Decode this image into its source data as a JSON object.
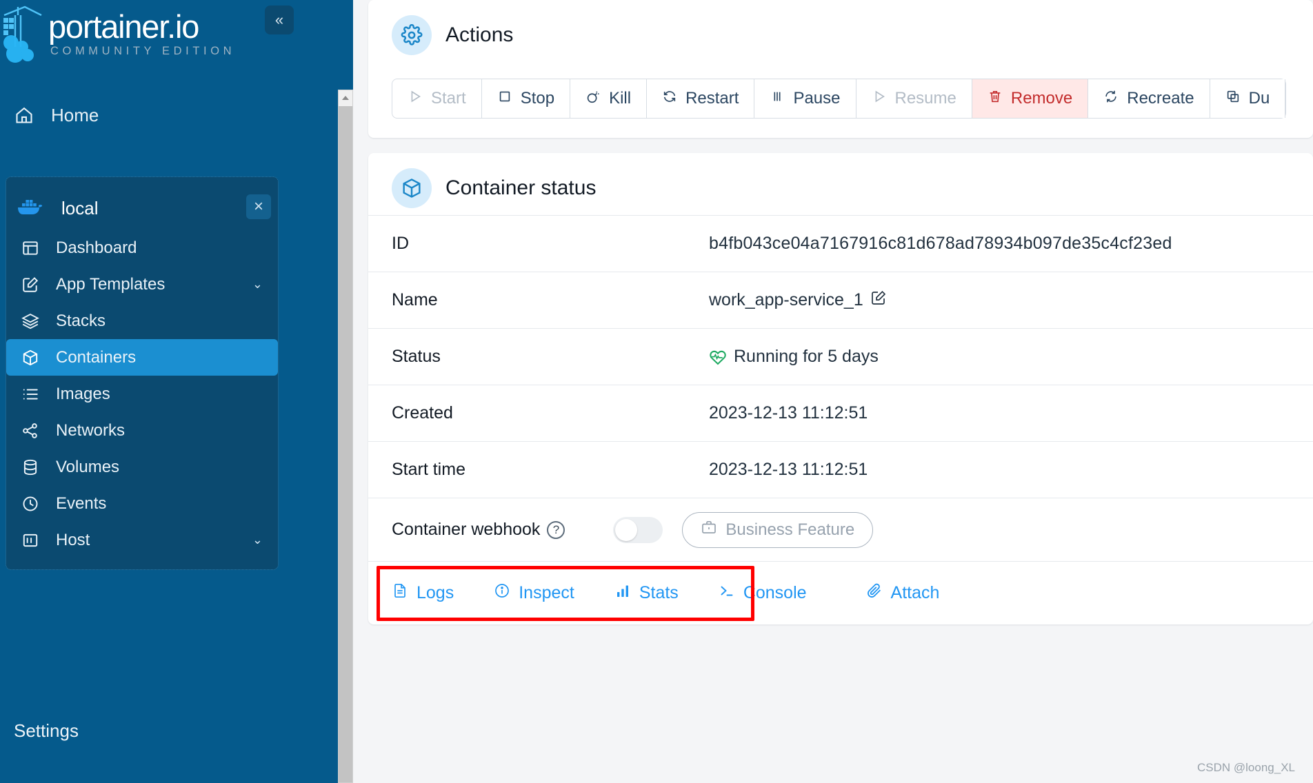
{
  "brand": {
    "name": "portainer.io",
    "edition": "COMMUNITY EDITION",
    "collapse_label": "«",
    "logo_icon": "portainer-crane-logo"
  },
  "sidebar": {
    "home": {
      "label": "Home",
      "icon": "home-icon"
    },
    "environment": {
      "name": "local",
      "icon": "docker-whale-icon",
      "close_label": "×"
    },
    "items": [
      {
        "label": "Dashboard",
        "icon": "dashboard-icon",
        "active": false,
        "chevron": ""
      },
      {
        "label": "App Templates",
        "icon": "edit-square-icon",
        "active": false,
        "chevron": "⌄"
      },
      {
        "label": "Stacks",
        "icon": "layers-icon",
        "active": false,
        "chevron": ""
      },
      {
        "label": "Containers",
        "icon": "cube-icon",
        "active": true,
        "chevron": ""
      },
      {
        "label": "Images",
        "icon": "list-icon",
        "active": false,
        "chevron": ""
      },
      {
        "label": "Networks",
        "icon": "share-nodes-icon",
        "active": false,
        "chevron": ""
      },
      {
        "label": "Volumes",
        "icon": "database-icon",
        "active": false,
        "chevron": ""
      },
      {
        "label": "Events",
        "icon": "clock-icon",
        "active": false,
        "chevron": ""
      },
      {
        "label": "Host",
        "icon": "server-panel-icon",
        "active": false,
        "chevron": "⌄"
      }
    ],
    "settings": {
      "label": "Settings"
    }
  },
  "actions": {
    "title": "Actions",
    "icon": "gear-icon",
    "buttons": [
      {
        "label": "Start",
        "icon": "play-icon",
        "state": "disabled"
      },
      {
        "label": "Stop",
        "icon": "square-icon",
        "state": "normal"
      },
      {
        "label": "Kill",
        "icon": "bomb-icon",
        "state": "normal"
      },
      {
        "label": "Restart",
        "icon": "refresh-icon",
        "state": "normal"
      },
      {
        "label": "Pause",
        "icon": "pause-icon",
        "state": "normal"
      },
      {
        "label": "Resume",
        "icon": "play-icon",
        "state": "disabled"
      },
      {
        "label": "Remove",
        "icon": "trash-icon",
        "state": "danger"
      },
      {
        "label": "Recreate",
        "icon": "recycle-icon",
        "state": "normal"
      },
      {
        "label": "Du",
        "icon": "copy-icon",
        "state": "normal"
      }
    ]
  },
  "container_status": {
    "title": "Container status",
    "icon": "cube-icon",
    "rows": [
      {
        "key": "ID",
        "value": "b4fb043ce04a7167916c81d678ad78934b097de35c4cf23ed"
      },
      {
        "key": "Name",
        "value": "work_app-service_1",
        "edit_icon": "pencil-icon"
      },
      {
        "key": "Status",
        "value": "Running for 5 days",
        "status_icon": "heartbeat-icon"
      },
      {
        "key": "Created",
        "value": "2023-12-13 11:12:51"
      },
      {
        "key": "Start time",
        "value": "2023-12-13 11:12:51"
      }
    ],
    "webhook": {
      "label": "Container webhook",
      "help_icon": "question-circle-icon",
      "toggle_state": "off",
      "badge_label": "Business Feature",
      "badge_icon": "briefcase-icon"
    },
    "links": [
      {
        "label": "Logs",
        "icon": "document-icon"
      },
      {
        "label": "Inspect",
        "icon": "info-circle-icon"
      },
      {
        "label": "Stats",
        "icon": "bar-chart-icon"
      },
      {
        "label": "Console",
        "icon": "terminal-icon"
      },
      {
        "label": "Attach",
        "icon": "paperclip-icon"
      }
    ]
  },
  "watermark": "CSDN @loong_XL",
  "colors": {
    "sidebar_bg": "#055a8c",
    "sidebar_panel": "#0b4a70",
    "active_item": "#1b8fd1",
    "link_blue": "#2196f3",
    "danger": "#c32c2c",
    "danger_bg": "#ffe8e7",
    "status_green": "#1faa62",
    "annotation_red": "#ff0000"
  }
}
